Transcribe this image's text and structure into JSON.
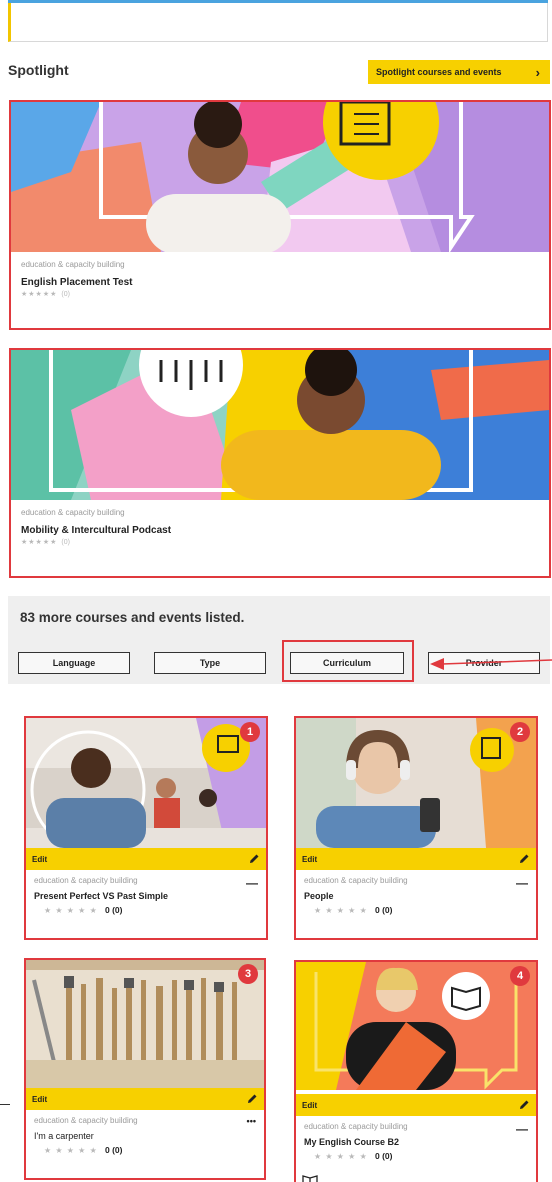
{
  "spotlight": {
    "title": "Spotlight",
    "button_label": "Spotlight courses and events",
    "cards": [
      {
        "category": "education & capacity building",
        "title": "English Placement Test",
        "rating_count": "(0)"
      },
      {
        "category": "education & capacity building",
        "title": "Mobility & Intercultural Podcast",
        "rating_count": "(0)"
      }
    ]
  },
  "listing": {
    "heading": "83 more courses and events listed.",
    "filters": [
      "Language",
      "Type",
      "Curriculum",
      "Provider"
    ]
  },
  "courses": [
    {
      "number": "1",
      "edit_label": "Edit",
      "category": "education & capacity building",
      "title": "Present Perfect VS Past Simple",
      "rating": "0 (0)"
    },
    {
      "number": "2",
      "edit_label": "Edit",
      "category": "education & capacity building",
      "title": "People",
      "rating": "0 (0)"
    },
    {
      "number": "3",
      "edit_label": "Edit",
      "category": "education & capacity building",
      "title": "I'm a carpenter",
      "rating": "0 (0)"
    },
    {
      "number": "4",
      "edit_label": "Edit",
      "category": "education & capacity building",
      "title": "My English Course B2",
      "rating": "0 (0)"
    }
  ],
  "colors": {
    "accent": "#f7d000",
    "highlight": "#e0393e"
  },
  "icons": [
    "chevron-right-icon",
    "star-icon",
    "pencil-icon",
    "dash-icon",
    "book-icon",
    "arrow-left-icon"
  ]
}
